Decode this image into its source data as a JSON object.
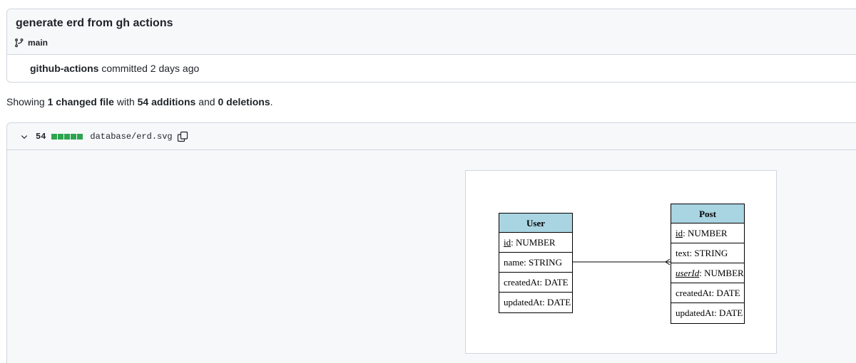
{
  "commit": {
    "title": "generate erd from gh actions",
    "branch": "main",
    "author": "github-actions",
    "action": "committed 2 days ago"
  },
  "summary": {
    "prefix": "Showing",
    "changed": "1 changed file",
    "with": "with",
    "additions": "54 additions",
    "and": "and",
    "deletions": "0 deletions",
    "end": "."
  },
  "file": {
    "additions_count": "54",
    "path": "database/erd.svg"
  },
  "erd": {
    "user": {
      "name": "User",
      "fields": [
        {
          "key": "id",
          "type": ": NUMBER"
        },
        {
          "key": "name: STRING"
        },
        {
          "key": "createdAt: DATE"
        },
        {
          "key": "updatedAt: DATE"
        }
      ]
    },
    "post": {
      "name": "Post",
      "fields": [
        {
          "key": "id",
          "type": ": NUMBER"
        },
        {
          "key": "text: STRING"
        },
        {
          "key": "userId",
          "type": ": NUMBER"
        },
        {
          "key": "createdAt: DATE"
        },
        {
          "key": "updatedAt: DATE"
        }
      ]
    }
  },
  "colors": {
    "header_bg": "#f6f8fa",
    "border": "#d0d7de",
    "diffstat_green": "#2da44e",
    "entity_header": "#a9d4e2"
  }
}
